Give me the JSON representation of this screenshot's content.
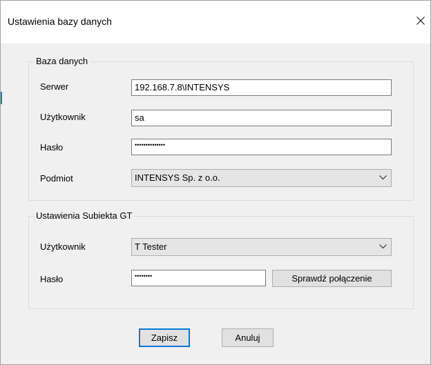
{
  "window": {
    "title": "Ustawienia bazy danych"
  },
  "database_group": {
    "legend": "Baza danych",
    "server_label": "Serwer",
    "server_value": "192.168.7.8\\INTENSYS",
    "user_label": "Użytkownik",
    "user_value": "sa",
    "password_label": "Hasło",
    "password_value": "••••••••••••••",
    "entity_label": "Podmiot",
    "entity_value": "INTENSYS Sp. z o.o."
  },
  "subiekt_group": {
    "legend": "Ustawienia Subiekta GT",
    "user_label": "Użytkownik",
    "user_value": "T Tester",
    "password_label": "Hasło",
    "password_value": "••••••••",
    "test_button": "Sprawdź połączenie"
  },
  "buttons": {
    "save": "Zapisz",
    "cancel": "Anuluj"
  },
  "icons": {
    "close": "close-icon",
    "dropdown": "chevron-down-icon"
  },
  "colors": {
    "dialog_bg": "#f0f0f0",
    "title_bg": "#ffffff",
    "focus_accent": "#0078d7"
  }
}
